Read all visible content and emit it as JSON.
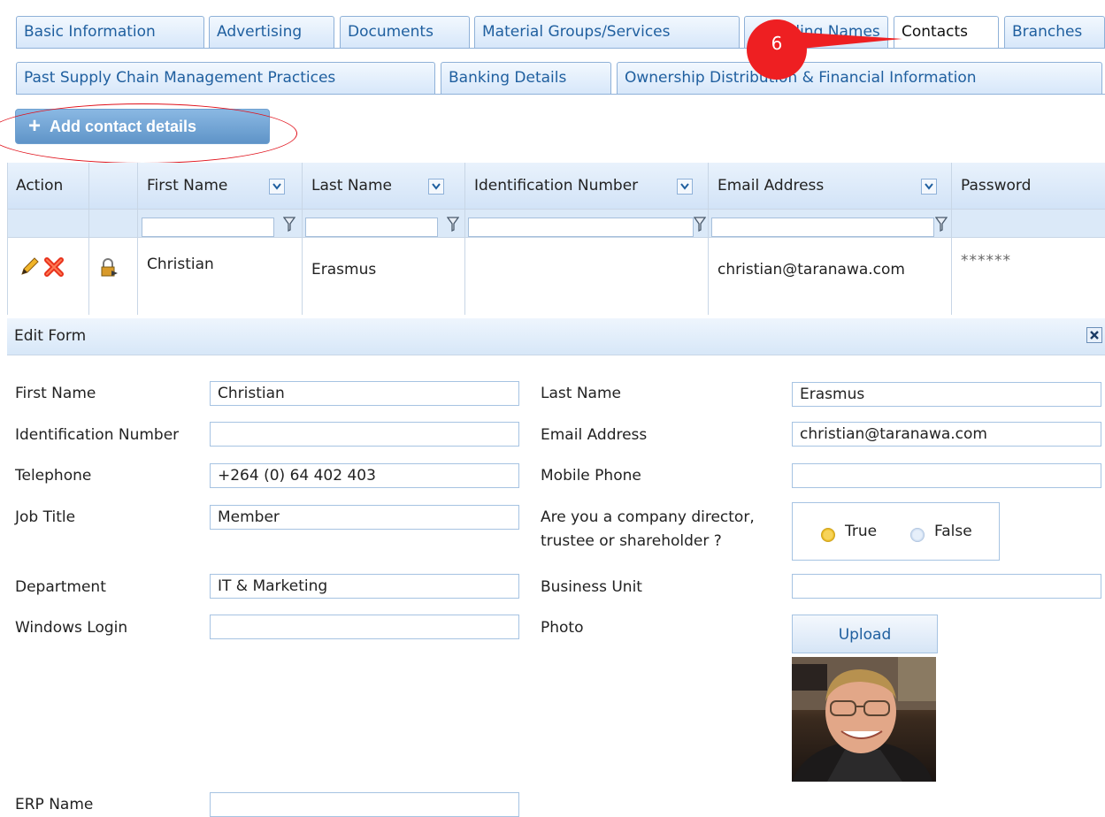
{
  "tabs_row1": [
    {
      "label": "Basic Information"
    },
    {
      "label": "Advertising"
    },
    {
      "label": "Documents"
    },
    {
      "label": "Material Groups/Services"
    },
    {
      "label": "Trading Names"
    },
    {
      "label": "Contacts",
      "active": true
    },
    {
      "label": "Branches"
    }
  ],
  "tabs_row2": [
    {
      "label": "Past Supply Chain Management Practices"
    },
    {
      "label": "Banking Details"
    },
    {
      "label": "Ownership Distribution & Financial Information"
    }
  ],
  "callout": {
    "number": "6",
    "color": "#ee1f22"
  },
  "add_button": {
    "label": "Add contact details",
    "icon": "plus-icon"
  },
  "grid": {
    "columns": [
      "Action",
      "",
      "First Name",
      "Last Name",
      "Identification Number",
      "Email Address",
      "Password"
    ],
    "rows": [
      {
        "first_name": "Christian",
        "last_name": "Erasmus",
        "identification_number": "",
        "email": "christian@taranawa.com",
        "password": "******"
      }
    ]
  },
  "edit_form": {
    "title": "Edit Form",
    "labels": {
      "first_name": "First Name",
      "last_name": "Last Name",
      "identification_number": "Identification Number",
      "email": "Email Address",
      "telephone": "Telephone",
      "mobile": "Mobile Phone",
      "job_title": "Job Title",
      "director_q1": "Are you a company director,",
      "director_q2": "trustee or shareholder ?",
      "department": "Department",
      "business_unit": "Business Unit",
      "windows_login": "Windows Login",
      "photo": "Photo",
      "erp_name": "ERP Name"
    },
    "values": {
      "first_name": "Christian",
      "last_name": "Erasmus",
      "identification_number": "",
      "email": "christian@taranawa.com",
      "telephone": "+264 (0) 64 402 403",
      "mobile": "",
      "job_title": "Member",
      "department": "IT & Marketing",
      "business_unit": "",
      "windows_login": "",
      "erp_name": ""
    },
    "director": {
      "true_label": "True",
      "false_label": "False",
      "selected": "True"
    },
    "upload_label": "Upload"
  },
  "colors": {
    "accent": "#1f5f9f",
    "annotation": "#e0101a"
  }
}
